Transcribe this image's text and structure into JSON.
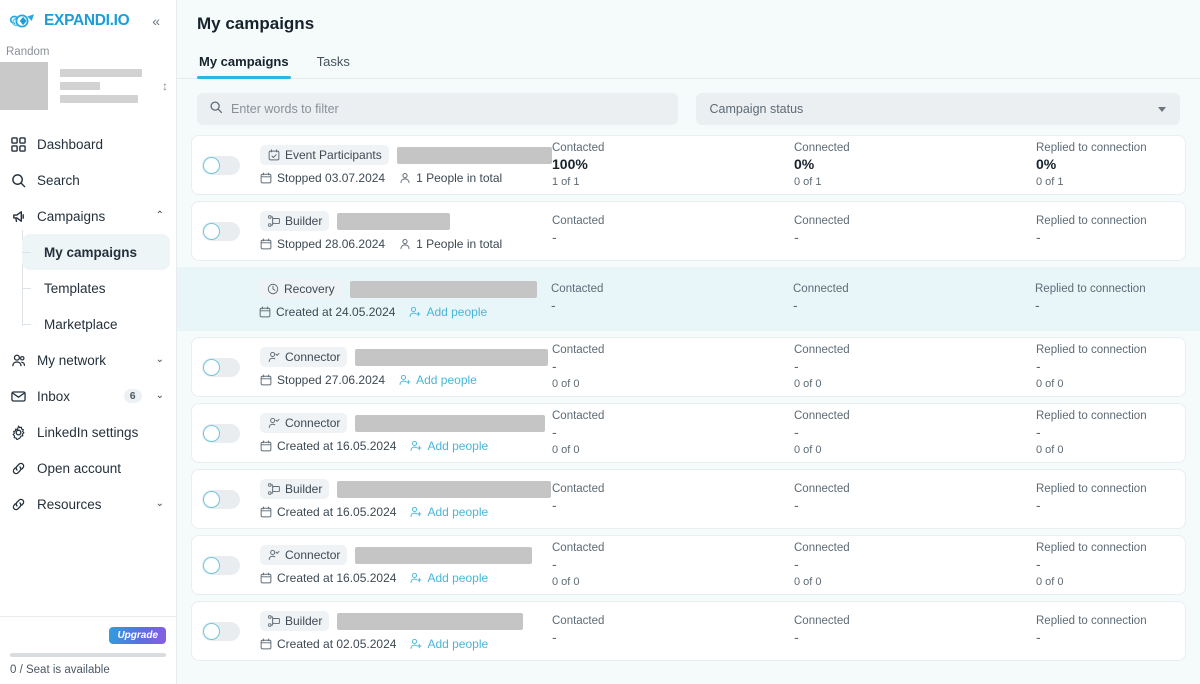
{
  "brand": {
    "name": "EXPANDI.IO",
    "logo_icon": "rocket-logo-icon",
    "collapse_icon": "chevron-double-left-icon",
    "accent": "#1b9dd9"
  },
  "sidebar": {
    "org_label": "Random",
    "account_switcher_icon": "sort-updown-icon",
    "items": [
      {
        "label": "Dashboard",
        "icon": "grid-dashboard-icon",
        "chevron": ""
      },
      {
        "label": "Search",
        "icon": "magnifier-icon",
        "chevron": ""
      },
      {
        "label": "Campaigns",
        "icon": "megaphone-icon",
        "chevron": "⌃"
      },
      {
        "label": "My network",
        "icon": "people-icon",
        "chevron": "⌄"
      },
      {
        "label": "Inbox",
        "icon": "envelope-icon",
        "chevron": "⌄",
        "badge": "6"
      },
      {
        "label": "LinkedIn settings",
        "icon": "gear-icon",
        "chevron": ""
      },
      {
        "label": "Open account",
        "icon": "link-icon",
        "chevron": ""
      },
      {
        "label": "Resources",
        "icon": "link-icon",
        "chevron": "⌄"
      }
    ],
    "campaigns_subnav": [
      {
        "label": "My campaigns",
        "active": true
      },
      {
        "label": "Templates",
        "active": false
      },
      {
        "label": "Marketplace",
        "active": false
      }
    ],
    "footer": {
      "upgrade_label": "Upgrade",
      "seat_text": "0 / Seat is available",
      "seat_progress_percent": 0
    }
  },
  "header": {
    "title": "My campaigns"
  },
  "tabs": [
    {
      "label": "My campaigns",
      "active": true
    },
    {
      "label": "Tasks",
      "active": false
    }
  ],
  "filters": {
    "search_placeholder": "Enter words to filter",
    "search_value": "",
    "search_icon": "magnifier-icon",
    "status_label": "Campaign status",
    "status_caret_icon": "caret-down-icon"
  },
  "columns": [
    "Contacted",
    "Connected",
    "Replied to connection"
  ],
  "campaigns": [
    {
      "type": "Event Participants",
      "type_icon": "calendar-check-icon",
      "name_redacted_width": 160,
      "status_icon": "calendar-icon",
      "status_text": "Stopped 03.07.2024",
      "people_icon": "person-icon",
      "people_text": "1 People in total",
      "has_toggle": true,
      "toggle_on": false,
      "highlighted": false,
      "contacted": {
        "header": "Contacted",
        "value": "100%",
        "sub": "1 of 1"
      },
      "connected": {
        "header": "Connected",
        "value": "0%",
        "sub": "0 of 1"
      },
      "replied": {
        "header": "Replied to connection",
        "value": "0%",
        "sub": "0 of 1"
      }
    },
    {
      "type": "Builder",
      "type_icon": "builder-flow-icon",
      "name_redacted_width": 113,
      "status_icon": "calendar-icon",
      "status_text": "Stopped 28.06.2024",
      "people_icon": "person-icon",
      "people_text": "1 People in total",
      "has_toggle": true,
      "toggle_on": false,
      "highlighted": false,
      "contacted": {
        "header": "Contacted",
        "value": "-",
        "sub": ""
      },
      "connected": {
        "header": "Connected",
        "value": "-",
        "sub": ""
      },
      "replied": {
        "header": "Replied to connection",
        "value": "-",
        "sub": ""
      }
    },
    {
      "type": "Recovery",
      "type_icon": "clock-recovery-icon",
      "name_redacted_width": 187,
      "status_icon": "calendar-icon",
      "status_text": "Created at 24.05.2024",
      "people_icon": "add-person-icon",
      "people_text": "Add people",
      "people_is_link": true,
      "has_toggle": false,
      "toggle_on": false,
      "highlighted": true,
      "contacted": {
        "header": "Contacted",
        "value": "-",
        "sub": ""
      },
      "connected": {
        "header": "Connected",
        "value": "-",
        "sub": ""
      },
      "replied": {
        "header": "Replied to connection",
        "value": "-",
        "sub": ""
      }
    },
    {
      "type": "Connector",
      "type_icon": "person-check-icon",
      "name_redacted_width": 193,
      "status_icon": "calendar-icon",
      "status_text": "Stopped 27.06.2024",
      "people_icon": "add-person-icon",
      "people_text": "Add people",
      "people_is_link": true,
      "has_toggle": true,
      "toggle_on": false,
      "highlighted": false,
      "contacted": {
        "header": "Contacted",
        "value": "-",
        "sub": "0 of 0"
      },
      "connected": {
        "header": "Connected",
        "value": "-",
        "sub": "0 of 0"
      },
      "replied": {
        "header": "Replied to connection",
        "value": "-",
        "sub": "0 of 0"
      }
    },
    {
      "type": "Connector",
      "type_icon": "person-check-icon",
      "name_redacted_width": 190,
      "status_icon": "calendar-icon",
      "status_text": "Created at 16.05.2024",
      "people_icon": "add-person-icon",
      "people_text": "Add people",
      "people_is_link": true,
      "has_toggle": true,
      "toggle_on": false,
      "highlighted": false,
      "contacted": {
        "header": "Contacted",
        "value": "-",
        "sub": "0 of 0"
      },
      "connected": {
        "header": "Connected",
        "value": "-",
        "sub": "0 of 0"
      },
      "replied": {
        "header": "Replied to connection",
        "value": "-",
        "sub": "0 of 0"
      }
    },
    {
      "type": "Builder",
      "type_icon": "builder-flow-icon",
      "name_redacted_width": 214,
      "status_icon": "calendar-icon",
      "status_text": "Created at 16.05.2024",
      "people_icon": "add-person-icon",
      "people_text": "Add people",
      "people_is_link": true,
      "has_toggle": true,
      "toggle_on": false,
      "highlighted": false,
      "contacted": {
        "header": "Contacted",
        "value": "-",
        "sub": ""
      },
      "connected": {
        "header": "Connected",
        "value": "-",
        "sub": ""
      },
      "replied": {
        "header": "Replied to connection",
        "value": "-",
        "sub": ""
      }
    },
    {
      "type": "Connector",
      "type_icon": "person-check-icon",
      "name_redacted_width": 177,
      "status_icon": "calendar-icon",
      "status_text": "Created at 16.05.2024",
      "people_icon": "add-person-icon",
      "people_text": "Add people",
      "people_is_link": true,
      "has_toggle": true,
      "toggle_on": false,
      "highlighted": false,
      "contacted": {
        "header": "Contacted",
        "value": "-",
        "sub": "0 of 0"
      },
      "connected": {
        "header": "Connected",
        "value": "-",
        "sub": "0 of 0"
      },
      "replied": {
        "header": "Replied to connection",
        "value": "-",
        "sub": "0 of 0"
      }
    },
    {
      "type": "Builder",
      "type_icon": "builder-flow-icon",
      "name_redacted_width": 186,
      "status_icon": "calendar-icon",
      "status_text": "Created at 02.05.2024",
      "people_icon": "add-person-icon",
      "people_text": "Add people",
      "people_is_link": true,
      "has_toggle": true,
      "toggle_on": false,
      "highlighted": false,
      "contacted": {
        "header": "Contacted",
        "value": "-",
        "sub": ""
      },
      "connected": {
        "header": "Connected",
        "value": "-",
        "sub": ""
      },
      "replied": {
        "header": "Replied to connection",
        "value": "-",
        "sub": ""
      }
    }
  ]
}
